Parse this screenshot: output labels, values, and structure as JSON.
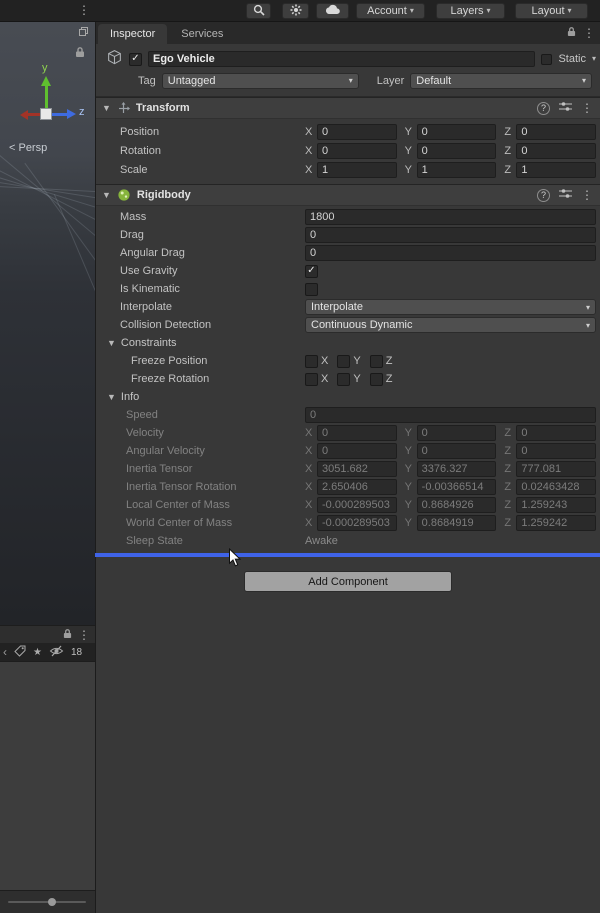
{
  "toolbar": {
    "account_label": "Account",
    "layers_label": "Layers",
    "layout_label": "Layout"
  },
  "icons": {
    "kebab": "⋮",
    "foldout_open": "▼",
    "dropdown_arrow": "▾",
    "check": "✓",
    "help": "?",
    "star": "★",
    "chevron_left": "‹"
  },
  "scene": {
    "axis_y_label": "y",
    "axis_z_label": "z",
    "persp_label": "< Persp",
    "hidden_count": "18"
  },
  "inspector": {
    "tab_inspector": "Inspector",
    "tab_services": "Services",
    "header": {
      "name_value": "Ego Vehicle",
      "static_label": "Static",
      "tag_label": "Tag",
      "tag_value": "Untagged",
      "layer_label": "Layer",
      "layer_value": "Default"
    },
    "axis": {
      "x": "X",
      "y": "Y",
      "z": "Z"
    },
    "transform": {
      "title": "Transform",
      "rows": [
        {
          "label": "Position",
          "x": "0",
          "y": "0",
          "z": "0"
        },
        {
          "label": "Rotation",
          "x": "0",
          "y": "0",
          "z": "0"
        },
        {
          "label": "Scale",
          "x": "1",
          "y": "1",
          "z": "1"
        }
      ]
    },
    "rigidbody": {
      "title": "Rigidbody",
      "mass_label": "Mass",
      "mass_value": "1800",
      "drag_label": "Drag",
      "drag_value": "0",
      "angular_drag_label": "Angular Drag",
      "angular_drag_value": "0",
      "use_gravity_label": "Use Gravity",
      "is_kinematic_label": "Is Kinematic",
      "interpolate_label": "Interpolate",
      "interpolate_value": "Interpolate",
      "collision_label": "Collision Detection",
      "collision_value": "Continuous Dynamic",
      "constraints_title": "Constraints",
      "freeze_position_label": "Freeze Position",
      "freeze_rotation_label": "Freeze Rotation",
      "info_title": "Info",
      "speed_label": "Speed",
      "speed_value": "0",
      "info_rows": [
        {
          "label": "Velocity",
          "x": "0",
          "y": "0",
          "z": "0"
        },
        {
          "label": "Angular Velocity",
          "x": "0",
          "y": "0",
          "z": "0"
        },
        {
          "label": "Inertia Tensor",
          "x": "3051.682",
          "y": "3376.327",
          "z": "777.081"
        },
        {
          "label": "Inertia Tensor Rotation",
          "x": "2.650406",
          "y": "-0.00366514",
          "z": "0.02463428"
        },
        {
          "label": "Local Center of Mass",
          "x": "-0.000289503",
          "y": "0.8684926",
          "z": "1.259243"
        },
        {
          "label": "World Center of Mass",
          "x": "-0.000289503",
          "y": "0.8684919",
          "z": "1.259242"
        }
      ],
      "sleep_state_label": "Sleep State",
      "sleep_state_value": "Awake"
    },
    "add_component_label": "Add Component"
  },
  "colors": {
    "drop_indicator": "#3f63e8"
  }
}
